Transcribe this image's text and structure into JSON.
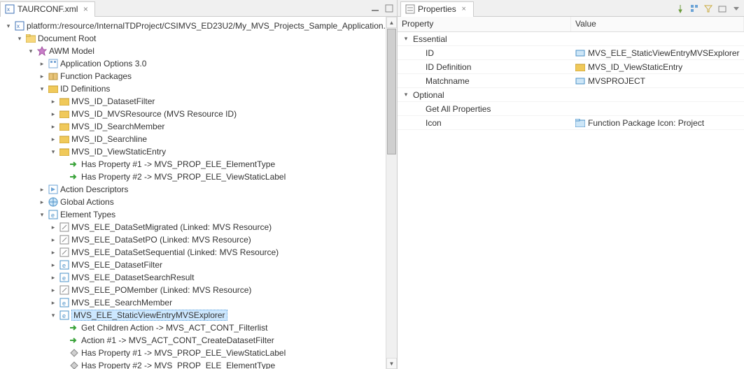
{
  "editor": {
    "tab_label": "TAURCONF.xml",
    "path": "platform:/resource/InternalTDProject/CSIMVS_ED23U2/My_MVS_Projects_Sample_Application."
  },
  "tree": {
    "doc_root": "Document Root",
    "awm_model": "AWM Model",
    "app_options": "Application Options 3.0",
    "func_packages": "Function Packages",
    "id_definitions": "ID Definitions",
    "id_dataset_filter": "MVS_ID_DatasetFilter",
    "id_mvsresource": "MVS_ID_MVSResource (MVS Resource ID)",
    "id_searchmember": "MVS_ID_SearchMember",
    "id_searchline": "MVS_ID_Searchline",
    "id_viewstatic": "MVS_ID_ViewStaticEntry",
    "has_prop1_etype": "Has Property #1 -> MVS_PROP_ELE_ElementType",
    "has_prop2_vslabel": "Has Property #2 -> MVS_PROP_ELE_ViewStaticLabel",
    "action_descriptors": "Action Descriptors",
    "global_actions": "Global Actions",
    "element_types": "Element Types",
    "ele_dsmigrated": "MVS_ELE_DataSetMigrated (Linked: MVS Resource)",
    "ele_dspo": "MVS_ELE_DataSetPO (Linked: MVS Resource)",
    "ele_dsseq": "MVS_ELE_DataSetSequential (Linked: MVS Resource)",
    "ele_dsfilter": "MVS_ELE_DatasetFilter",
    "ele_dssearch": "MVS_ELE_DatasetSearchResult",
    "ele_pomember": "MVS_ELE_POMember (Linked: MVS Resource)",
    "ele_searchmember": "MVS_ELE_SearchMember",
    "ele_staticview": "MVS_ELE_StaticViewEntryMVSExplorer",
    "get_children": "Get Children Action -> MVS_ACT_CONT_Filterlist",
    "action1": "Action #1  -> MVS_ACT_CONT_CreateDatasetFilter",
    "has_prop1_vsl": "Has Property #1 -> MVS_PROP_ELE_ViewStaticLabel",
    "has_prop2_etype": "Has Property #2 -> MVS_PROP_ELE_ElementType"
  },
  "properties": {
    "tab_label": "Properties",
    "col_property": "Property",
    "col_value": "Value",
    "group_essential": "Essential",
    "row_id_label": "ID",
    "row_id_value": "MVS_ELE_StaticViewEntryMVSExplorer",
    "row_iddef_label": "ID Definition",
    "row_iddef_value": "MVS_ID_ViewStaticEntry",
    "row_match_label": "Matchname",
    "row_match_value": "MVSPROJECT",
    "group_optional": "Optional",
    "row_getall_label": "Get All Properties",
    "row_getall_value": "",
    "row_icon_label": "Icon",
    "row_icon_value": "Function Package Icon: Project"
  }
}
